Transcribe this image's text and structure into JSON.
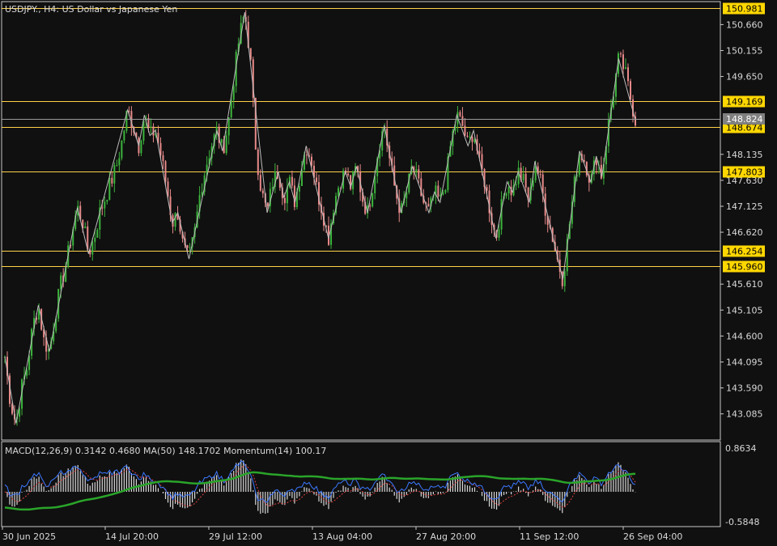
{
  "header": {
    "symbol_label": "USDJPY., H4:  US Dollar vs Japanese Yen"
  },
  "indicator": {
    "label": "MACD(12,26,9) 0.3142 0.4680 MA(50) 148.1702 Momentum(14) 100.17",
    "scale_top": "0.8634",
    "scale_bottom": "-0.5848"
  },
  "price_axis": {
    "ticks": [
      "150.660",
      "150.155",
      "149.650",
      "148.135",
      "147.630",
      "147.125",
      "146.620",
      "145.610",
      "145.105",
      "144.600",
      "144.095",
      "143.590",
      "143.085"
    ],
    "current_price": "148.824"
  },
  "levels": [
    {
      "label": "150.981",
      "value": 150.981
    },
    {
      "label": "149.169",
      "value": 149.169
    },
    {
      "label": "148.674",
      "value": 148.674
    },
    {
      "label": "147.803",
      "value": 147.803
    },
    {
      "label": "146.254",
      "value": 146.254
    },
    {
      "label": "145.960",
      "value": 145.96
    }
  ],
  "time_axis": {
    "labels": [
      "30 Jun 2025",
      "14 Jul 20:00",
      "29 Jul 12:00",
      "13 Aug 04:00",
      "27 Aug 20:00",
      "11 Sep 12:00",
      "26 Sep 04:00"
    ]
  },
  "colors": {
    "background": "#101010",
    "grid_border": "#c8c8c8",
    "level_line": "#ffd24a",
    "level_badge": "#ffd700",
    "bull_candle": "#3cb43c",
    "bear_candle": "#e88a8a",
    "zigzag": "#bcbcbc",
    "macd_line": "#3c78ff",
    "ma_line": "#2aa52a",
    "histogram": "#d8d8d8",
    "signal_line": "#e04040",
    "current_price_badge": "#808080"
  },
  "chart_data": {
    "type": "candlestick",
    "title": "USDJPY., H4:  US Dollar vs Japanese Yen",
    "timeframe": "H4",
    "ylim": [
      142.6,
      151.2
    ],
    "x_labels": [
      "30 Jun 2025",
      "14 Jul 20:00",
      "29 Jul 12:00",
      "13 Aug 04:00",
      "27 Aug 20:00",
      "11 Sep 12:00",
      "26 Sep 04:00"
    ],
    "close_path": [
      144.2,
      143.3,
      142.9,
      143.6,
      144.0,
      144.8,
      145.2,
      144.5,
      144.3,
      145.0,
      145.6,
      146.0,
      146.6,
      147.1,
      146.8,
      146.2,
      146.5,
      147.0,
      147.3,
      147.6,
      147.9,
      148.4,
      149.0,
      148.7,
      148.3,
      148.9,
      148.5,
      148.6,
      148.1,
      147.5,
      146.8,
      147.0,
      146.3,
      146.1,
      146.6,
      147.4,
      147.9,
      148.3,
      148.6,
      148.2,
      148.7,
      149.6,
      150.4,
      150.9,
      150.0,
      148.2,
      147.4,
      147.0,
      147.6,
      147.8,
      147.3,
      147.6,
      147.2,
      147.8,
      148.3,
      148.0,
      147.4,
      147.0,
      146.5,
      147.2,
      147.6,
      147.8,
      147.5,
      147.9,
      147.3,
      147.0,
      147.6,
      148.3,
      148.7,
      148.0,
      147.4,
      147.0,
      147.4,
      147.9,
      147.6,
      147.2,
      147.0,
      147.4,
      147.2,
      147.6,
      148.4,
      148.9,
      148.7,
      148.3,
      148.6,
      148.0,
      147.6,
      147.0,
      146.5,
      147.1,
      147.6,
      147.4,
      147.8,
      147.6,
      147.2,
      148.0,
      147.6,
      147.0,
      146.6,
      146.1,
      145.7,
      146.6,
      147.5,
      148.2,
      148.0,
      147.6,
      148.1,
      147.7,
      148.6,
      149.3,
      150.0,
      149.8,
      149.3,
      148.8
    ],
    "indicators": [
      "MACD(12,26,9)",
      "MA(50)",
      "Momentum(14)"
    ]
  }
}
